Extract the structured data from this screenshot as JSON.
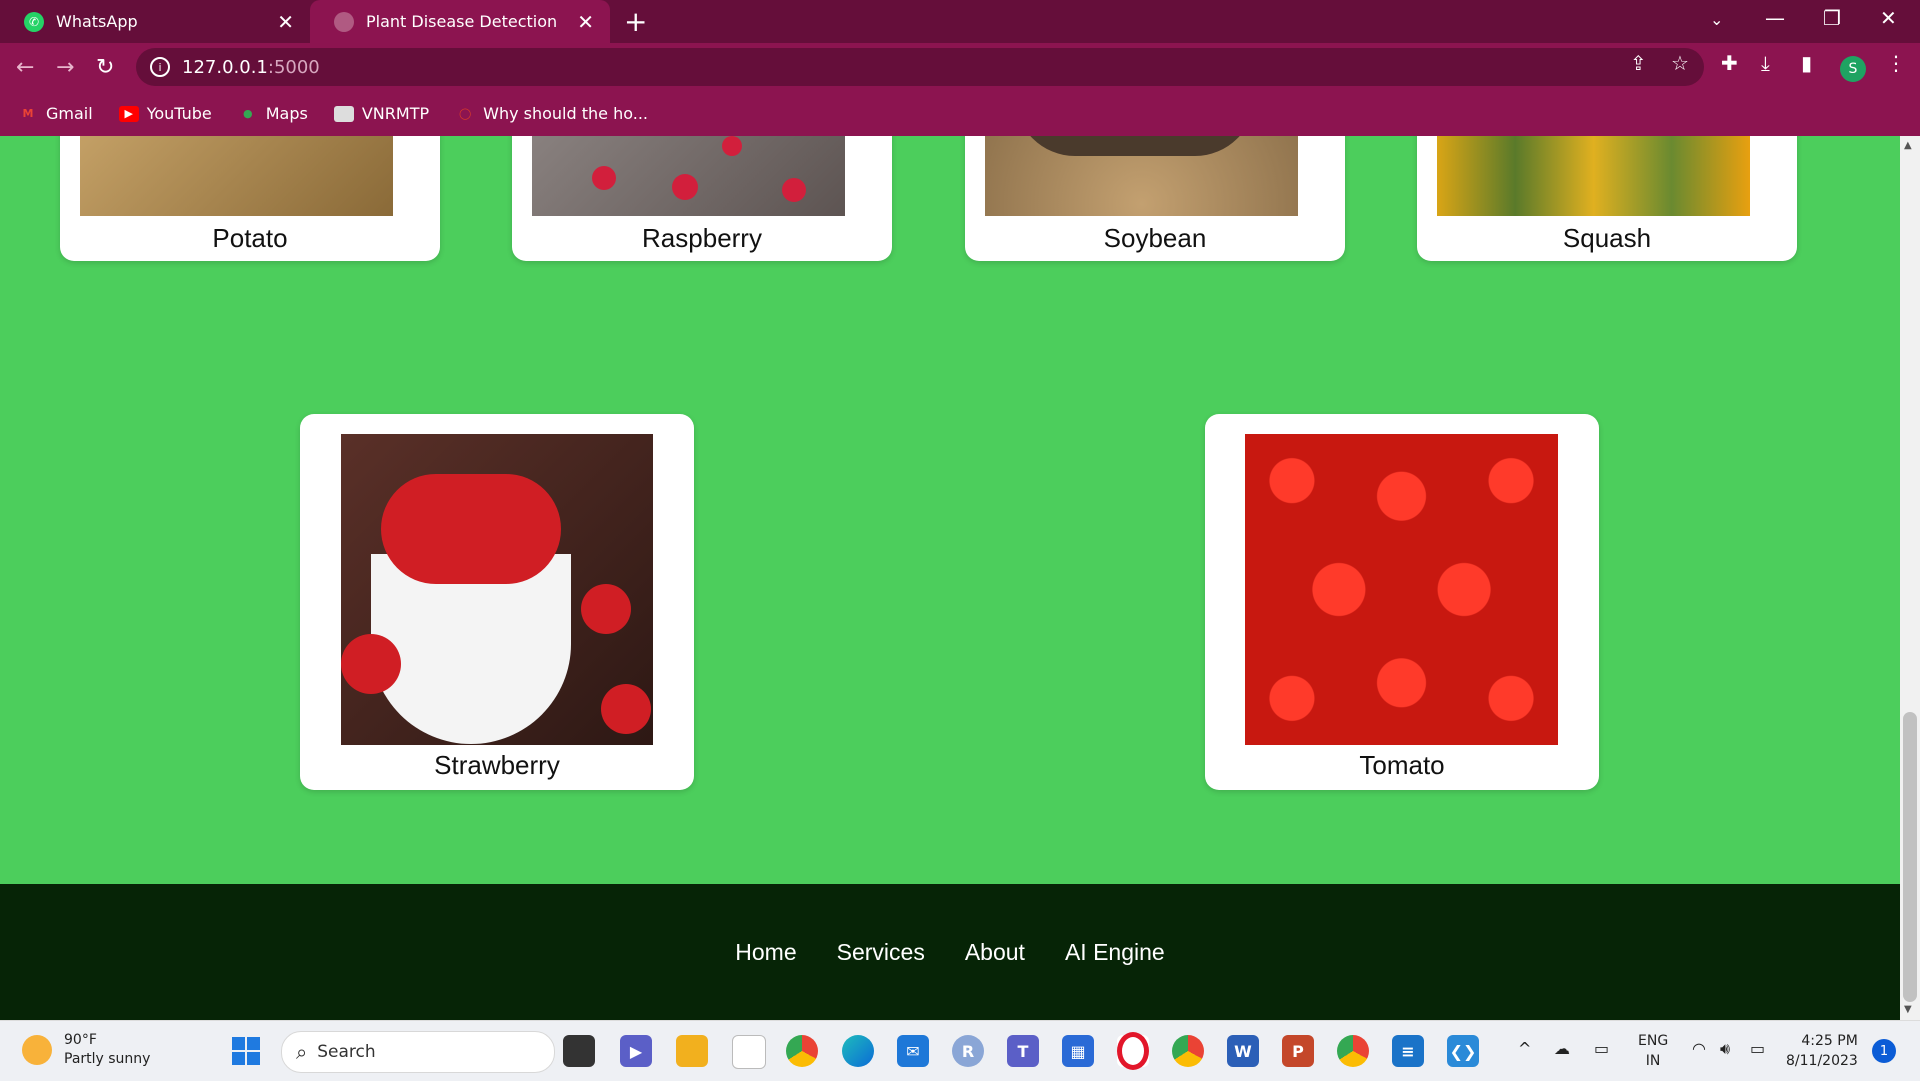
{
  "browser": {
    "tabs": [
      {
        "title": "WhatsApp"
      },
      {
        "title": "Plant Disease Detection"
      }
    ],
    "url_host": "127.0.0.1",
    "url_port": ":5000",
    "bookmarks": [
      {
        "label": "Gmail"
      },
      {
        "label": "YouTube"
      },
      {
        "label": "Maps"
      },
      {
        "label": "VNRMTP"
      },
      {
        "label": "Why should the ho..."
      }
    ],
    "profile_initial": "S"
  },
  "cards_row1": [
    {
      "label": "Potato",
      "color": "#b8925a"
    },
    {
      "label": "Raspberry",
      "color": "#8a7a78"
    },
    {
      "label": "Soybean",
      "color": "#a08055"
    },
    {
      "label": "Squash",
      "color": "#c8a020"
    }
  ],
  "cards_row2": [
    {
      "label": "Strawberry",
      "color": "#c8282a"
    },
    {
      "label": "Tomato",
      "color": "#e22418"
    }
  ],
  "footer": {
    "links": [
      "Home",
      "Services",
      "About",
      "AI Engine"
    ]
  },
  "taskbar": {
    "temperature": "90°F",
    "weather": "Partly sunny",
    "search_placeholder": "Search",
    "lang_top": "ENG",
    "lang_bottom": "IN",
    "time": "4:25 PM",
    "date": "8/11/2023",
    "notifications": "1"
  }
}
